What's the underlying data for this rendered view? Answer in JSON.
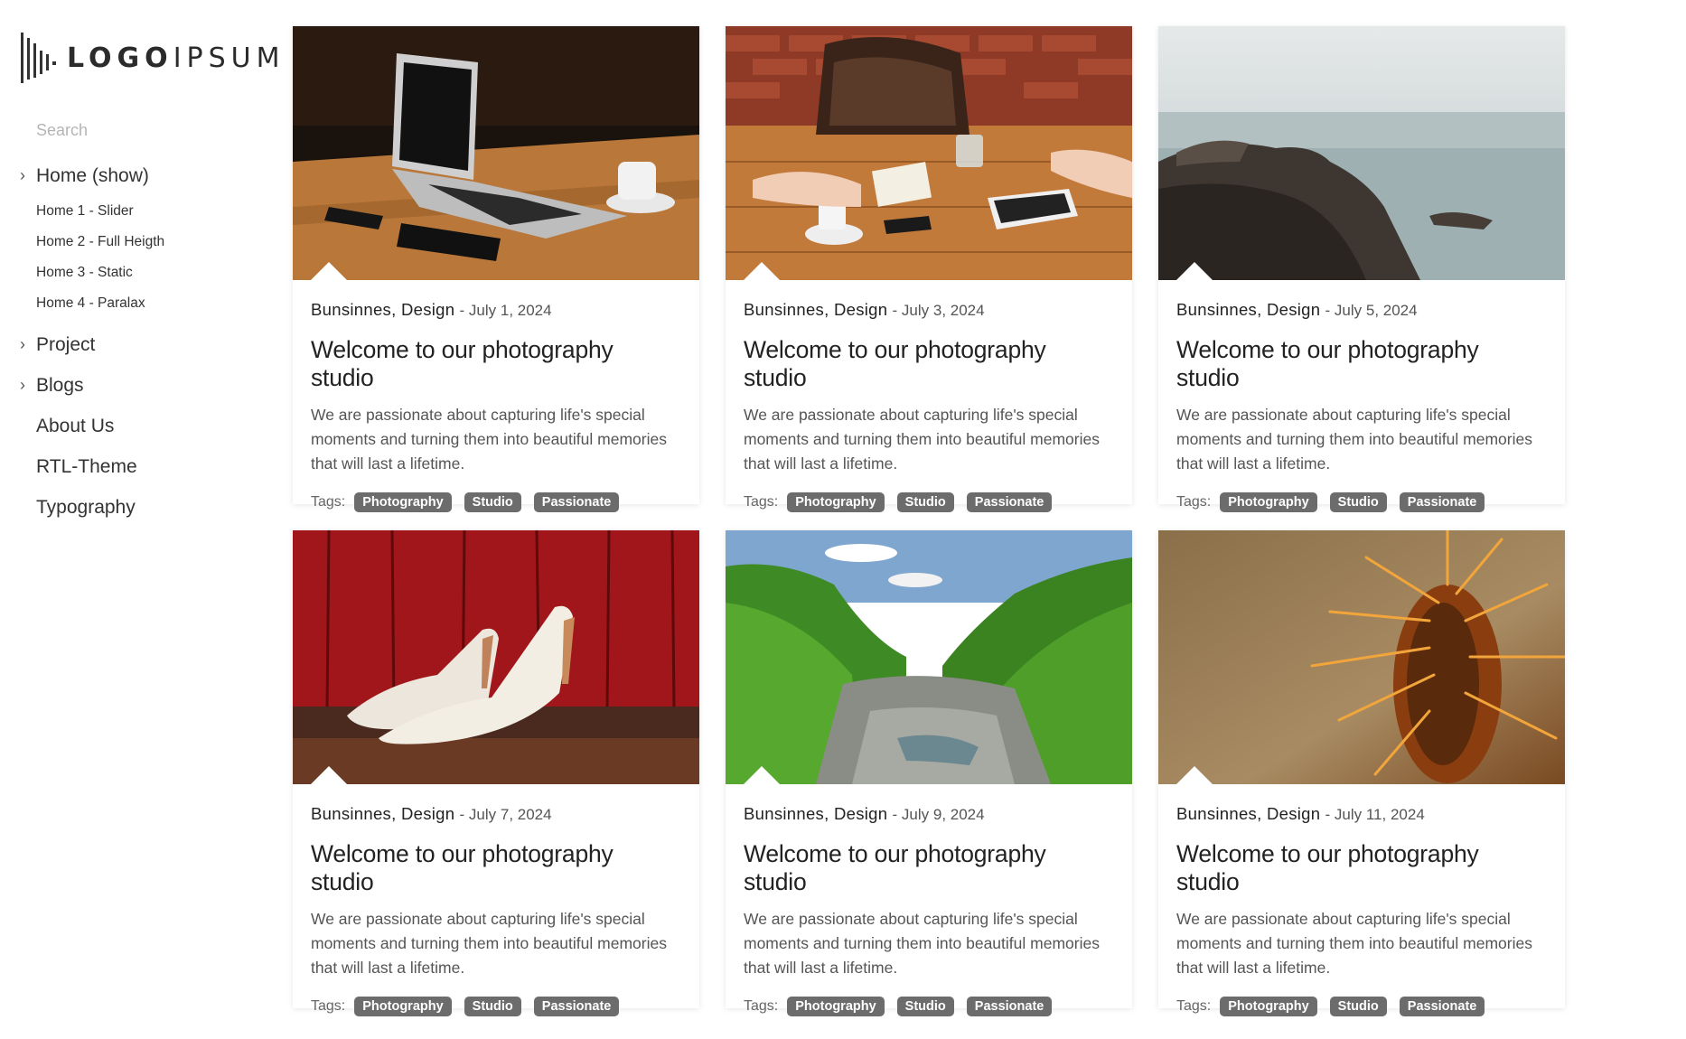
{
  "logo": {
    "text_bold": "LOGO",
    "text_light": "IPSUM",
    "icon": "logo-bars-icon"
  },
  "search": {
    "placeholder": "Search"
  },
  "nav": {
    "home": {
      "label": "Home (show)",
      "icon": "chevron-right-icon",
      "sub": [
        "Home 1 - Slider",
        "Home 2 - Full Heigth",
        "Home 3 - Static",
        "Home 4 - Paralax"
      ]
    },
    "project": {
      "label": "Project",
      "icon": "chevron-right-icon"
    },
    "blogs": {
      "label": "Blogs",
      "icon": "chevron-right-icon"
    },
    "about": {
      "label": "About Us"
    },
    "rtl": {
      "label": "RTL-Theme"
    },
    "typography": {
      "label": "Typography"
    }
  },
  "posts": [
    {
      "image": "laptop-on-table",
      "categories": "Bunsinnes, Design",
      "date": "July 1, 2024",
      "title": "Welcome to our photography studio",
      "excerpt": "We are passionate about capturing life's special moments and turning them into beautiful memories that will last a lifetime.",
      "tags_label": "Tags:",
      "tags": [
        "Photography",
        "Studio",
        "Passionate"
      ]
    },
    {
      "image": "meeting-table",
      "categories": "Bunsinnes, Design",
      "date": "July 3, 2024",
      "title": "Welcome to our photography studio",
      "excerpt": "We are passionate about capturing life's special moments and turning them into beautiful memories that will last a lifetime.",
      "tags_label": "Tags:",
      "tags": [
        "Photography",
        "Studio",
        "Passionate"
      ]
    },
    {
      "image": "rocky-coast",
      "categories": "Bunsinnes, Design",
      "date": "July 5, 2024",
      "title": "Welcome to our photography studio",
      "excerpt": "We are passionate about capturing life's special moments and turning them into beautiful memories that will last a lifetime.",
      "tags_label": "Tags:",
      "tags": [
        "Photography",
        "Studio",
        "Passionate"
      ]
    },
    {
      "image": "white-heels-red-wall",
      "categories": "Bunsinnes, Design",
      "date": "July 7, 2024",
      "title": "Welcome to our photography studio",
      "excerpt": "We are passionate about capturing life's special moments and turning them into beautiful memories that will last a lifetime.",
      "tags_label": "Tags:",
      "tags": [
        "Photography",
        "Studio",
        "Passionate"
      ]
    },
    {
      "image": "forest-river",
      "categories": "Bunsinnes, Design",
      "date": "July 9, 2024",
      "title": "Welcome to our photography studio",
      "excerpt": "We are passionate about capturing life's special moments and turning them into beautiful memories that will last a lifetime.",
      "tags_label": "Tags:",
      "tags": [
        "Photography",
        "Studio",
        "Passionate"
      ]
    },
    {
      "image": "cactus-closeup",
      "categories": "Bunsinnes, Design",
      "date": "July 11, 2024",
      "title": "Welcome to our photography studio",
      "excerpt": "We are passionate about capturing life's special moments and turning them into beautiful memories that will last a lifetime.",
      "tags_label": "Tags:",
      "tags": [
        "Photography",
        "Studio",
        "Passionate"
      ]
    }
  ],
  "colors": {
    "tag_bg": "#6c6c6c",
    "text": "#222222",
    "muted": "#555555"
  }
}
